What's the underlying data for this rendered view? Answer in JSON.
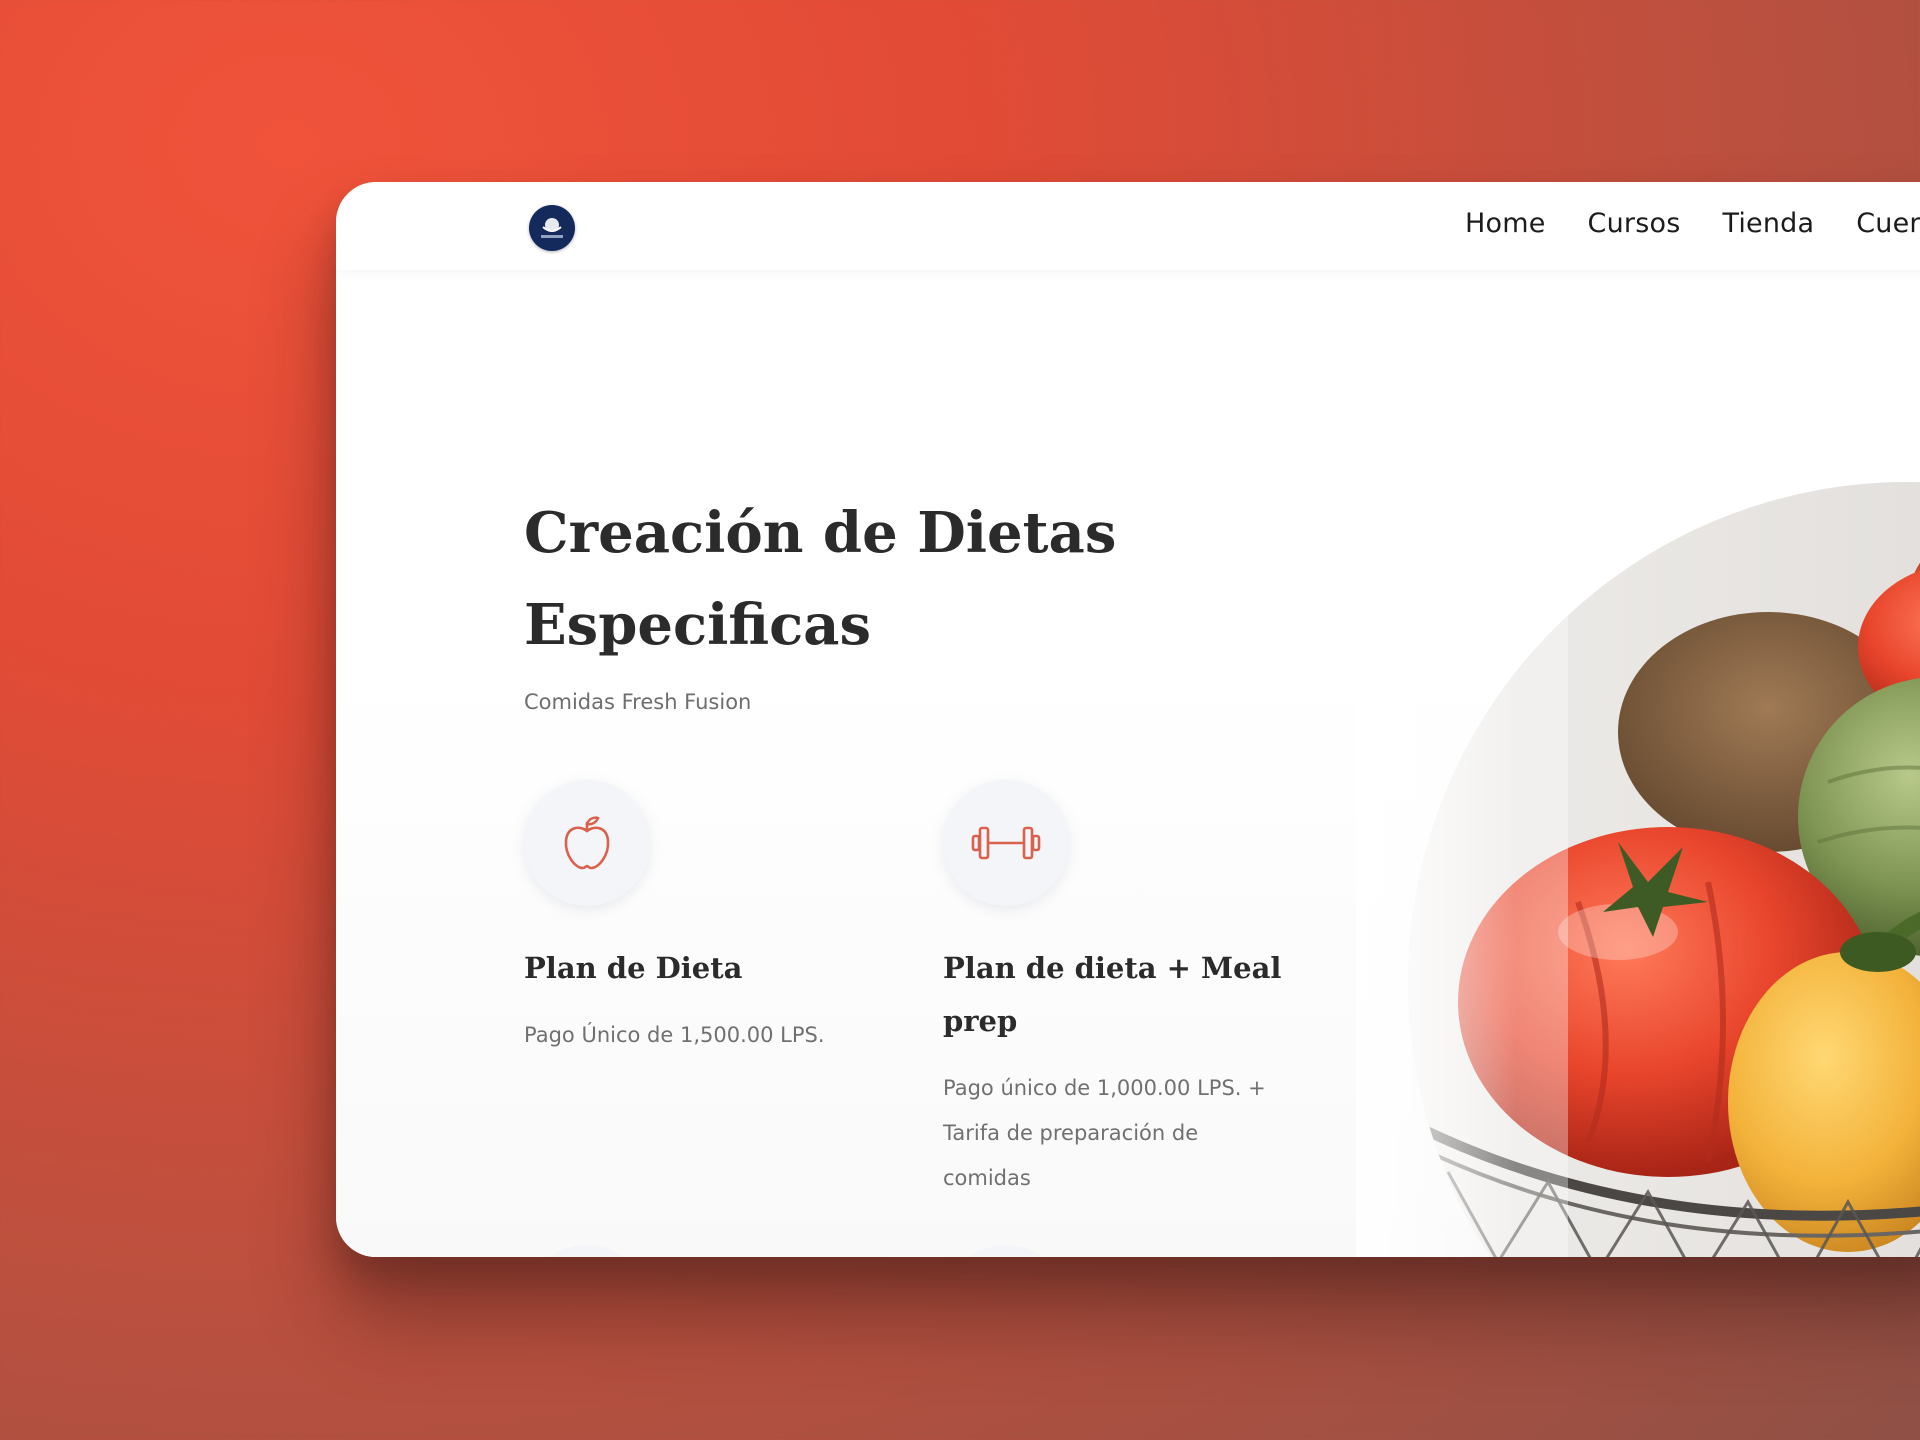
{
  "nav": {
    "logo_icon": "site-logo",
    "links": [
      "Home",
      "Cursos",
      "Tienda",
      "Cuen"
    ]
  },
  "hero": {
    "title": "Creación de Dietas Especificas",
    "subtitle": "Comidas Fresh Fusion"
  },
  "features": [
    {
      "icon": "apple-icon",
      "title": "Plan de Dieta",
      "description": "Pago Único de 1,500.00 LPS."
    },
    {
      "icon": "dumbbell-icon",
      "title": "Plan de dieta + Meal prep",
      "description": "Pago único de 1,000.00 LPS. + Tarifa de preparación de comidas"
    }
  ],
  "image": {
    "subject": "produce-basket-image"
  },
  "colors": {
    "background_orange": "#e14b36",
    "icon_accent": "#d9614d",
    "text_dark": "#2b2b2b",
    "text_muted": "#707070",
    "logo_navy": "#142a5c"
  }
}
